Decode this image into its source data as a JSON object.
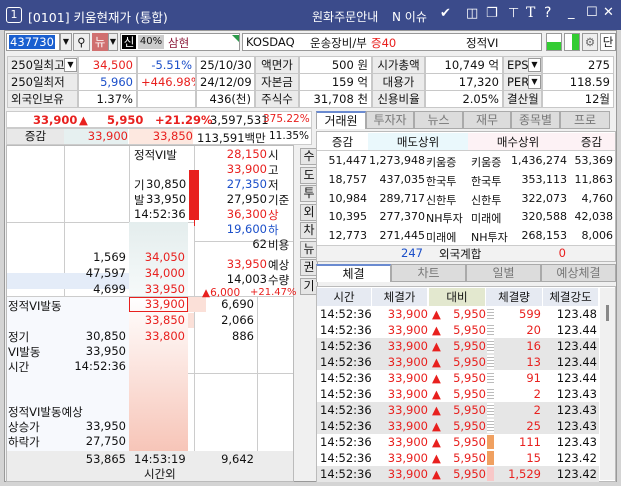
{
  "window": {
    "number": "1",
    "title": "[0101] 키움현재가 (통합)",
    "order_notice": "원화주문안내",
    "issue": "N 이슈",
    "icons": [
      "kiwoom-icon",
      "layout-icon",
      "copy-window-icon",
      "pin-icon",
      "font-icon",
      "help-icon",
      "minimize-icon",
      "maximize-icon",
      "close-icon"
    ]
  },
  "toolbar": {
    "code": "437730",
    "new_label": "뉴",
    "credit_label": "신",
    "margin": "40%",
    "name": "삼현",
    "market": "KOSDAQ",
    "sector": "운송장비/부",
    "margin_class": "증40",
    "vi_status": "정적VI",
    "unit_label": "단"
  },
  "info": [
    [
      "250일최고",
      "34,500",
      "-5.51%",
      "25/10/30",
      "액면가",
      "500 원",
      "시가총액",
      "10,749 억",
      "EPS",
      "275"
    ],
    [
      "250일최저",
      "5,960",
      "+446.98%",
      "24/12/09",
      "자본금",
      "159 억",
      "대용가",
      "17,320",
      "PER",
      "118.59"
    ],
    [
      "외국인보유",
      "1.37%",
      "",
      "436(천)",
      "주식수",
      "31,708 천",
      "신용비율",
      "2.05%",
      "결산월",
      "12월"
    ]
  ],
  "quote": {
    "price": "33,900",
    "arrow": "▲",
    "change": "5,950",
    "rate": "+21.29%",
    "volume": "3,597,531",
    "vol_rate": "375.22%",
    "diff_label": "증감",
    "ask1": "33,900",
    "bid1": "33,850",
    "amount": "113,591백만",
    "turnover": "11.35%"
  },
  "vi": {
    "title": "정적VI발",
    "base_label": "기",
    "base": "30,850",
    "trig_label": "발",
    "trig": "33,950",
    "time": "14:52:36"
  },
  "summary": [
    [
      "28,150",
      "시"
    ],
    [
      "33,900",
      "고"
    ],
    [
      "27,350",
      "저"
    ],
    [
      "27,950",
      "기준"
    ],
    [
      "36,300",
      "상"
    ],
    [
      "19,600",
      "하"
    ],
    [
      "62",
      "비용"
    ]
  ],
  "expected": {
    "price": "33,950",
    "price_label": "예상",
    "qty": "14,003",
    "qty_label": "수량",
    "change": "▲6,000",
    "rate": "+21.47%"
  },
  "side_buttons": [
    "수",
    "도",
    "투",
    "외",
    "차",
    "뉴",
    "권",
    "기"
  ],
  "asks": [
    [
      "1,569",
      "34,050"
    ],
    [
      "47,597",
      "34,000"
    ],
    [
      "4,699",
      "33,950"
    ]
  ],
  "bids": [
    [
      "33,900",
      "6,690"
    ],
    [
      "33,850",
      "2,066"
    ],
    [
      "33,800",
      "886"
    ]
  ],
  "vi_active": {
    "title": "정적VI발동",
    "base_label": "정기",
    "base": "30,850",
    "trig_label": "VI발동",
    "trig": "33,950",
    "time_label": "시간",
    "time": "14:52:36",
    "exp_title": "정적VI발동예상",
    "up_label": "상승가",
    "up": "33,950",
    "down_label": "하락가",
    "down": "27,750"
  },
  "footer": {
    "ask_total": "53,865",
    "time": "14:53:19",
    "bid_total": "9,642",
    "after_hours": "시간외"
  },
  "tabs_top": [
    "거래원",
    "투자자",
    "뉴스",
    "재무",
    "종목별",
    "프로"
  ],
  "brokers": {
    "headers": [
      "증감",
      "매도상위",
      "매수상위",
      "증감"
    ],
    "rows": [
      [
        "51,447",
        "1,273,948",
        "키움증",
        "키움증",
        "1,436,274",
        "53,369"
      ],
      [
        "18,757",
        "437,035",
        "한국투",
        "한국투",
        "353,113",
        "11,863"
      ],
      [
        "10,984",
        "289,717",
        "신한투",
        "신한투",
        "322,073",
        "4,760"
      ],
      [
        "10,395",
        "277,370",
        "NH투자",
        "미래에",
        "320,588",
        "42,038"
      ],
      [
        "12,773",
        "271,445",
        "미래에",
        "NH투자",
        "268,153",
        "8,006"
      ]
    ],
    "foreign_sell": "247",
    "foreign_label": "외국계합",
    "foreign_buy": "0"
  },
  "tabs_bottom": [
    "체결",
    "차트",
    "일별",
    "예상체결"
  ],
  "trades": {
    "headers": [
      "시간",
      "체결가",
      "대비",
      "체결량",
      "체결강도"
    ],
    "rows": [
      [
        "14:52:36",
        "33,900",
        "▲",
        "5,950",
        "599",
        "123.48"
      ],
      [
        "14:52:36",
        "33,900",
        "▲",
        "5,950",
        "20",
        "123.44"
      ],
      [
        "14:52:36",
        "33,900",
        "▲",
        "5,950",
        "16",
        "123.44"
      ],
      [
        "14:52:36",
        "33,900",
        "▲",
        "5,950",
        "13",
        "123.44"
      ],
      [
        "14:52:36",
        "33,900",
        "▲",
        "5,950",
        "91",
        "123.44"
      ],
      [
        "14:52:36",
        "33,900",
        "▲",
        "5,950",
        "2",
        "123.43"
      ],
      [
        "14:52:36",
        "33,900",
        "▲",
        "5,950",
        "2",
        "123.43"
      ],
      [
        "14:52:36",
        "33,900",
        "▲",
        "5,950",
        "25",
        "123.43"
      ],
      [
        "14:52:36",
        "33,900",
        "▲",
        "5,950",
        "111",
        "123.43"
      ],
      [
        "14:52:36",
        "33,900",
        "▲",
        "5,950",
        "15",
        "123.42"
      ],
      [
        "14:52:36",
        "33,900",
        "▲",
        "5,950",
        "1,529",
        "123.42"
      ]
    ]
  },
  "colors": {
    "up": "#e8201e",
    "down": "#1b4fc9",
    "title_bar": "#3b4b8b"
  }
}
